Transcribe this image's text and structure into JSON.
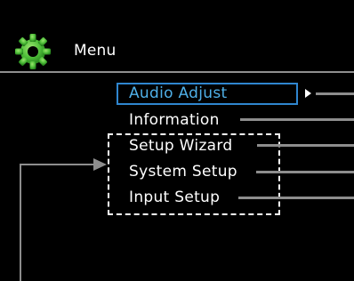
{
  "header": {
    "title": "Menu",
    "icon": "gear-icon"
  },
  "menu": {
    "items": [
      {
        "label": "Audio Adjust",
        "selected": true
      },
      {
        "label": "Information",
        "selected": false
      },
      {
        "label": "Setup Wizard",
        "selected": false
      },
      {
        "label": "System Setup",
        "selected": false
      },
      {
        "label": "Input Setup",
        "selected": false
      }
    ],
    "submenu_indicator": "triangle-right-icon"
  },
  "colors": {
    "background": "#000000",
    "text": "#ffffff",
    "selected_text": "#4fb0e8",
    "selection_border": "#2f86cf",
    "leader_line": "#8d8d8d",
    "gear_fill": "#4fbf3a"
  }
}
